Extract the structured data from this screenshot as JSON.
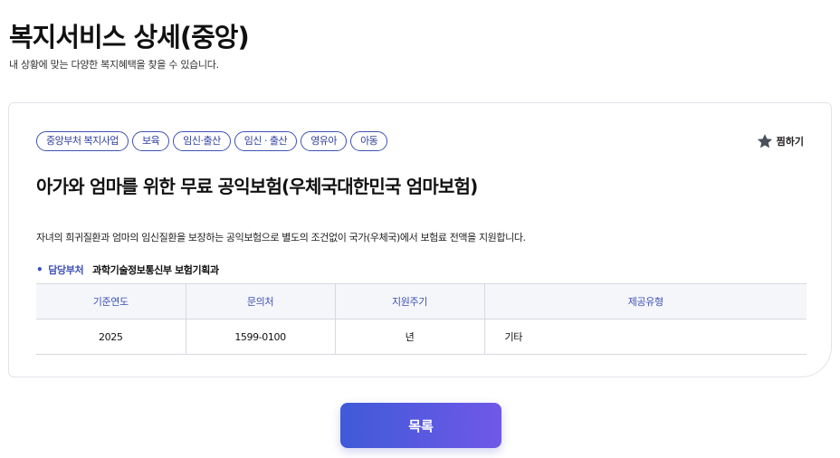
{
  "header": {
    "title": "복지서비스 상세(중앙)",
    "subtitle": "내 상황에 맞는 다양한 복지혜택을 찾을 수 있습니다."
  },
  "service": {
    "tags": [
      "중앙부처 복지사업",
      "보육",
      "임신·출산",
      "임신 · 출산",
      "영유아",
      "아동"
    ],
    "bookmark_label": "찜하기",
    "title": "아가와 엄마를 위한 무료 공익보험(우체국대한민국 엄마보험)",
    "description": "자녀의 희귀질환과 엄마의 임신질환을 보장하는 공익보험으로 별도의 조건없이 국가(우체국)에서 보험료 전액을 지원합니다.",
    "department_label": "담당부처",
    "department_value": "과학기술정보통신부 보험기획과",
    "table": {
      "headers": [
        "기준연도",
        "문의처",
        "지원주기",
        "제공유형"
      ],
      "row": [
        "2025",
        "1599-0100",
        "년",
        "기타"
      ]
    }
  },
  "footer": {
    "list_button_label": "목록"
  },
  "colors": {
    "accent": "#3f51b5",
    "button_gradient_start": "#3f5ad8",
    "button_gradient_end": "#7058e8"
  }
}
